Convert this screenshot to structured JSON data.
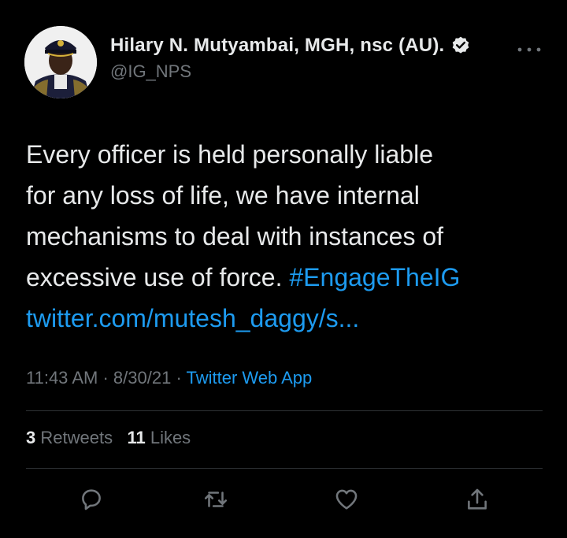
{
  "author": {
    "name": "Hilary N. Mutyambai, MGH, nsc (AU).",
    "handle": "@IG_NPS"
  },
  "tweet": {
    "text_line1": "Every officer is held personally liable",
    "text_line2": "for any loss of life, we have internal",
    "text_line3": "mechanisms to deal with instances of",
    "text_line4": "excessive use of force.",
    "hashtag": "#EngageTheIG",
    "link": "twitter.com/mutesh_daggy/s..."
  },
  "meta": {
    "time": "11:43 AM",
    "separator": "·",
    "date": "8/30/21",
    "source": "Twitter Web App"
  },
  "stats": {
    "retweets_count": "3",
    "retweets_label": "Retweets",
    "likes_count": "11",
    "likes_label": "Likes"
  },
  "icons": {
    "verified": "verified-badge-icon",
    "more": "more-dots-icon",
    "reply": "reply-icon",
    "retweet": "retweet-icon",
    "like": "heart-icon",
    "share": "share-icon"
  },
  "colors": {
    "background": "#000000",
    "text": "#e7e9ea",
    "secondary": "#71767b",
    "link": "#1d9bf0",
    "divider": "#2f3336"
  }
}
